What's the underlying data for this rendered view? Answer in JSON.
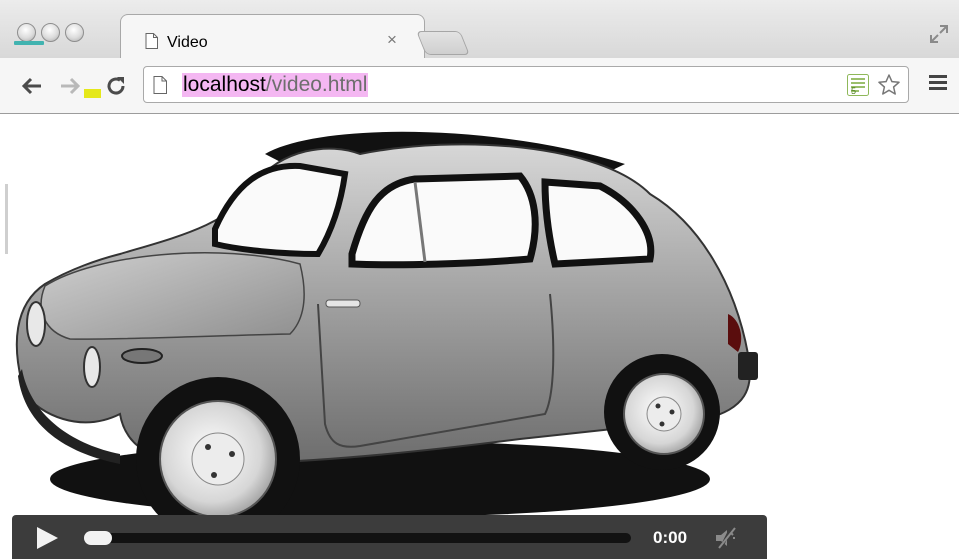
{
  "window": {
    "traffic_lights": [
      "close-button",
      "minimize-button",
      "zoom-button"
    ]
  },
  "tab": {
    "title": "Video",
    "close_glyph": "×"
  },
  "toolbar": {
    "back_icon": "arrow-left-icon",
    "forward_icon": "arrow-right-icon",
    "reload_icon": "reload-icon",
    "menu_icon": "hamburger-icon"
  },
  "address": {
    "host": "localhost",
    "path": "/video.html",
    "page_icon": "page-icon",
    "extension_icon": "html5-icon",
    "bookmark_icon": "star-icon"
  },
  "video": {
    "subject": "car",
    "controls": {
      "play_icon": "play-icon",
      "time": "0:00",
      "progress": 0,
      "mute_icon": "muted-speaker-icon"
    }
  },
  "colors": {
    "url_highlight": "#f4b7f2",
    "traffic_accent": "#41b3b0",
    "controls_bg": "#3c3c3c"
  }
}
